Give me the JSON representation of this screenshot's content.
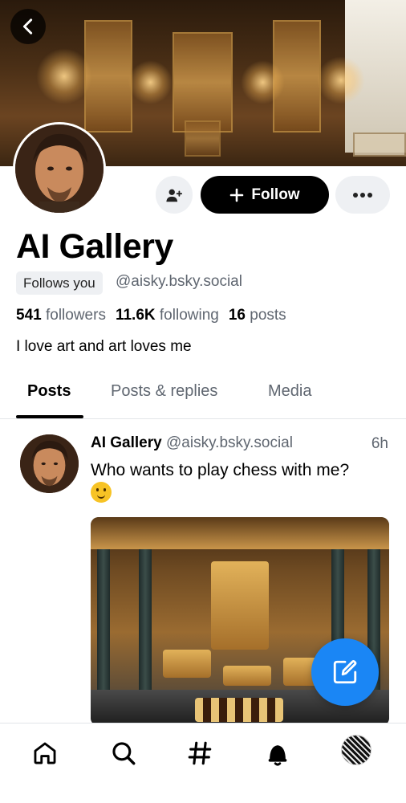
{
  "profile": {
    "display_name": "AI Gallery",
    "follows_you_badge": "Follows you",
    "handle": "@aisky.bsky.social",
    "followers_count": "541",
    "followers_label": "followers",
    "following_count": "11.6K",
    "following_label": "following",
    "posts_count": "16",
    "posts_label": "posts",
    "bio": "I love art and art loves me"
  },
  "actions": {
    "follow_label": "Follow"
  },
  "tabs": [
    {
      "label": "Posts",
      "active": true
    },
    {
      "label": "Posts & replies",
      "active": false
    },
    {
      "label": "Media",
      "active": false
    }
  ],
  "post": {
    "author_name": "AI Gallery",
    "author_handle": "@aisky.bsky.social",
    "time": "6h",
    "text": "Who wants to play chess with me?"
  },
  "nav": {
    "items": [
      "home-icon",
      "search-icon",
      "hashtag-icon",
      "notifications-icon",
      "profile-avatar"
    ]
  },
  "colors": {
    "accent": "#1a86f5",
    "follow_button_bg": "#000000",
    "muted_text": "#5f6670",
    "chip_bg": "#eef0f3"
  }
}
